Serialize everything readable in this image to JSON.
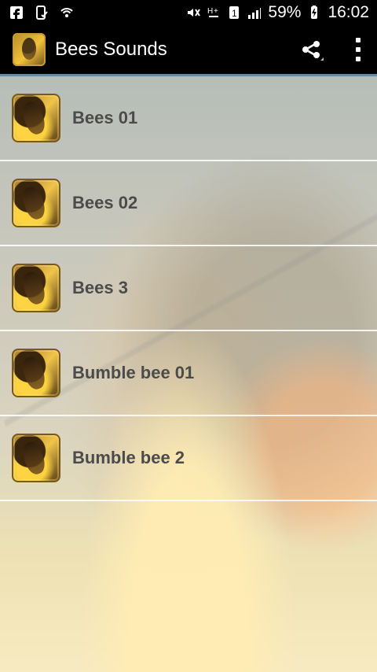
{
  "status_bar": {
    "battery_percent": "59%",
    "time": "16:02",
    "left_icons": [
      "facebook-icon",
      "phone-check-icon",
      "wifi-icon"
    ],
    "right_icons": [
      "mute-icon",
      "signal-h-icon",
      "sim-1-icon",
      "cell-signal-icon",
      "battery-icon"
    ]
  },
  "action_bar": {
    "title": "Bees Sounds",
    "actions": [
      "share-icon",
      "overflow-menu-icon"
    ]
  },
  "list": {
    "items": [
      {
        "label": "Bees 01"
      },
      {
        "label": "Bees 02"
      },
      {
        "label": "Bees 3"
      },
      {
        "label": "Bumble bee 01"
      },
      {
        "label": "Bumble bee 2"
      }
    ]
  }
}
